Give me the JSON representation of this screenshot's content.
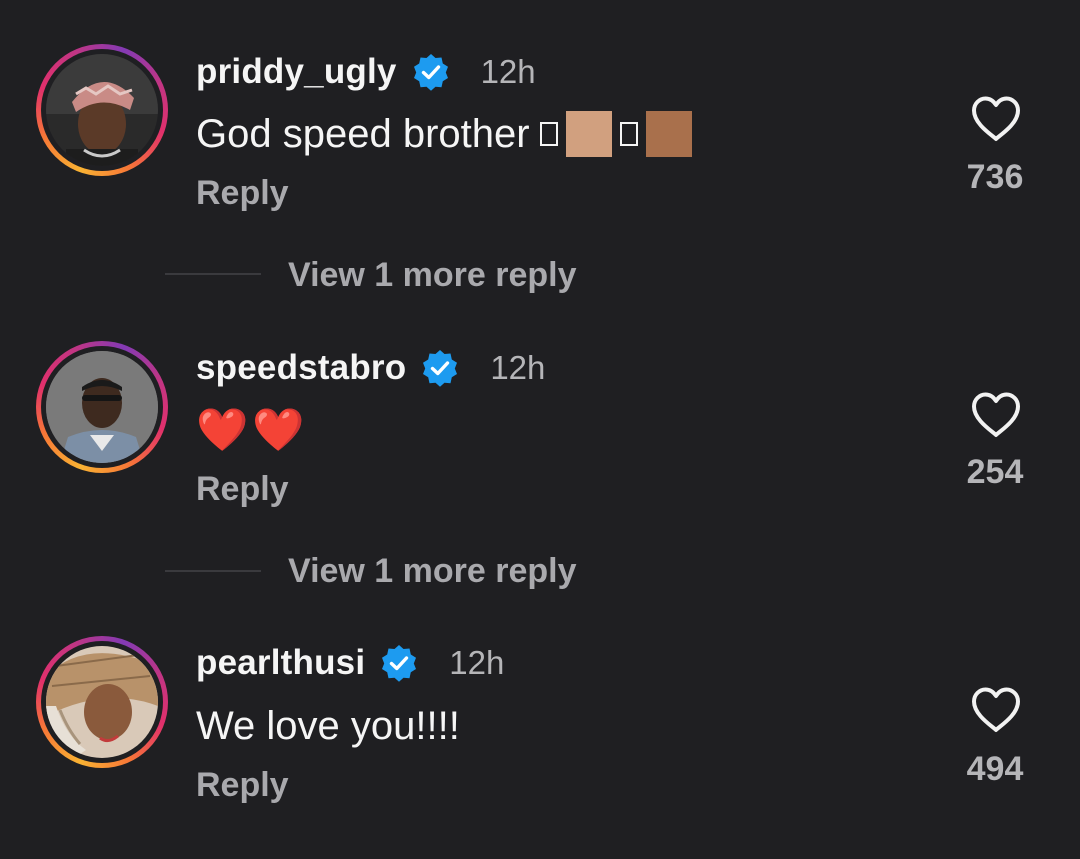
{
  "comments": [
    {
      "username": "priddy_ugly",
      "verified": true,
      "timestamp": "12h",
      "text": "God speed brother",
      "reply_label": "Reply",
      "likes": "736",
      "view_more": "View 1 more reply"
    },
    {
      "username": "speedstabro",
      "verified": true,
      "timestamp": "12h",
      "text": "❤️❤️",
      "reply_label": "Reply",
      "likes": "254",
      "view_more": "View 1 more reply"
    },
    {
      "username": "pearlthusi",
      "verified": true,
      "timestamp": "12h",
      "text": "We love you!!!!",
      "reply_label": "Reply",
      "likes": "494"
    }
  ],
  "colors": {
    "background": "#1f1f22",
    "verified_badge": "#1d9bf0",
    "heart_emoji": "#e53935",
    "muted_text": "#a9a9ad"
  },
  "icons": {
    "verified": "verified-badge-icon",
    "like": "heart-outline-icon"
  }
}
